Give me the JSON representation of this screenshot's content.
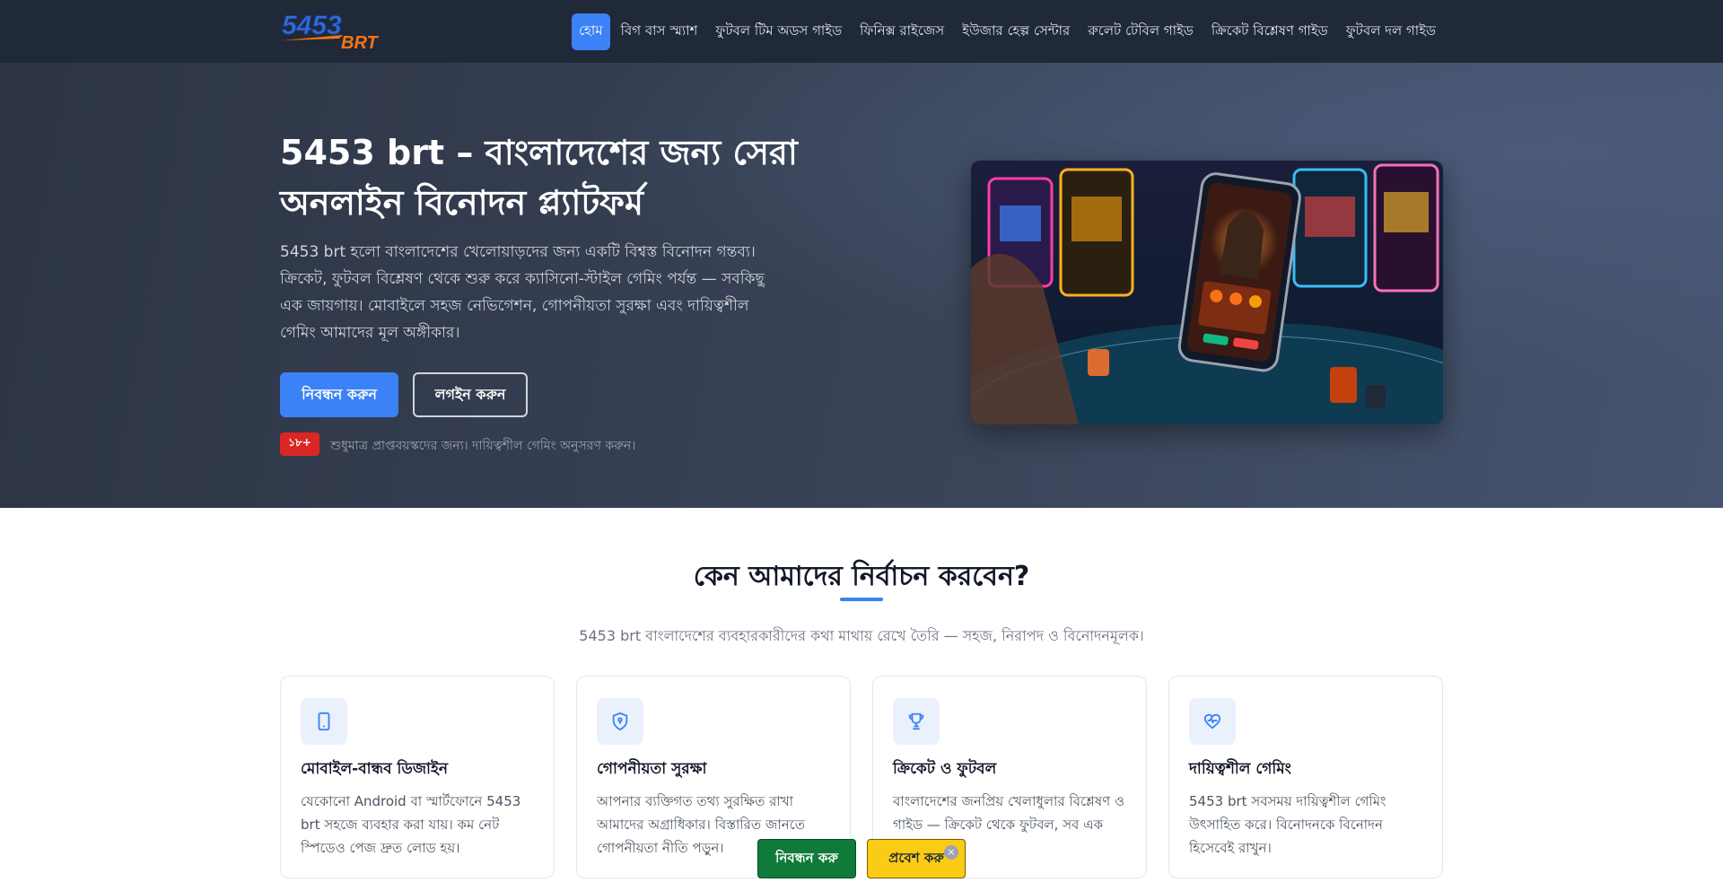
{
  "logo": {
    "line1": "5453",
    "line2": "BRT"
  },
  "nav": {
    "items": [
      {
        "label": "হোম",
        "active": true
      },
      {
        "label": "বিগ বাস স্ম্যাশ"
      },
      {
        "label": "ফুটবল টিম অডস গাইড"
      },
      {
        "label": "ফিনিক্স রাইজেস"
      },
      {
        "label": "ইউজার হেল্প সেন্টার"
      },
      {
        "label": "রুলেট টেবিল গাইড"
      },
      {
        "label": "ক্রিকেট বিশ্লেষণ গাইড"
      },
      {
        "label": "ফুটবল দল গাইড"
      }
    ]
  },
  "hero": {
    "title": "5453 brt – বাংলাদেশের জন্য সেরা অনলাইন বিনোদন প্ল্যাটফর্ম",
    "description": "5453 brt হলো বাংলাদেশের খেলোয়াড়দের জন্য একটি বিশ্বস্ত বিনোদন গন্তব্য। ক্রিকেট, ফুটবল বিশ্লেষণ থেকে শুরু করে ক্যাসিনো-স্টাইল গেমিং পর্যন্ত — সবকিছু এক জায়গায়। মোবাইলে সহজ নেভিগেশন, গোপনীয়তা সুরক্ষা এবং দায়িত্বশীল গেমিং আমাদের মূল অঙ্গীকার।",
    "register_label": "নিবন্ধন করুন",
    "login_label": "লগইন করুন",
    "age_badge": "১৮+",
    "age_note": "শুধুমাত্র প্রাপ্তবয়স্কদের জন্য। দায়িত্বশীল গেমিং অনুসরণ করুন।"
  },
  "why": {
    "title": "কেন আমাদের নির্বাচন করবেন?",
    "subtitle": "5453 brt বাংলাদেশের ব্যবহারকারীদের কথা মাথায় রেখে তৈরি — সহজ, নিরাপদ ও বিনোদনমূলক।",
    "cards": [
      {
        "icon": "smartphone-icon",
        "title": "মোবাইল-বান্ধব ডিজাইন",
        "text": "যেকোনো Android বা স্মার্টফোনে 5453 brt সহজে ব্যবহার করা যায়। কম নেট স্পিডেও পেজ দ্রুত লোড হয়।"
      },
      {
        "icon": "shield-icon",
        "title": "গোপনীয়তা সুরক্ষা",
        "text": "আপনার ব্যক্তিগত তথ্য সুরক্ষিত রাখা আমাদের অগ্রাধিকার। বিস্তারিত জানতে গোপনীয়তা নীতি পড়ুন।"
      },
      {
        "icon": "trophy-icon",
        "title": "ক্রিকেট ও ফুটবল",
        "text": "বাংলাদেশের জনপ্রিয় খেলাধুলার বিশ্লেষণ ও গাইড — ক্রিকেট থেকে ফুটবল, সব এক জায়গায়।"
      },
      {
        "icon": "heart-pulse-icon",
        "title": "দায়িত্বশীল গেমিং",
        "text": "5453 brt সবসময় দায়িত্বশীল গেমিং উৎসাহিত করে। বিনোদনকে বিনোদন হিসেবেই রাখুন।"
      }
    ]
  },
  "floating": {
    "register_label": "নিবন্ধন করু",
    "enter_label": "প্রবেশ করু",
    "close_glyph": "×"
  },
  "colors": {
    "accent": "#3b82f6",
    "header_bg": "#1f2937",
    "badge_red": "#dc2626",
    "float_green": "#0f7a3a",
    "float_yellow": "#facc15"
  }
}
